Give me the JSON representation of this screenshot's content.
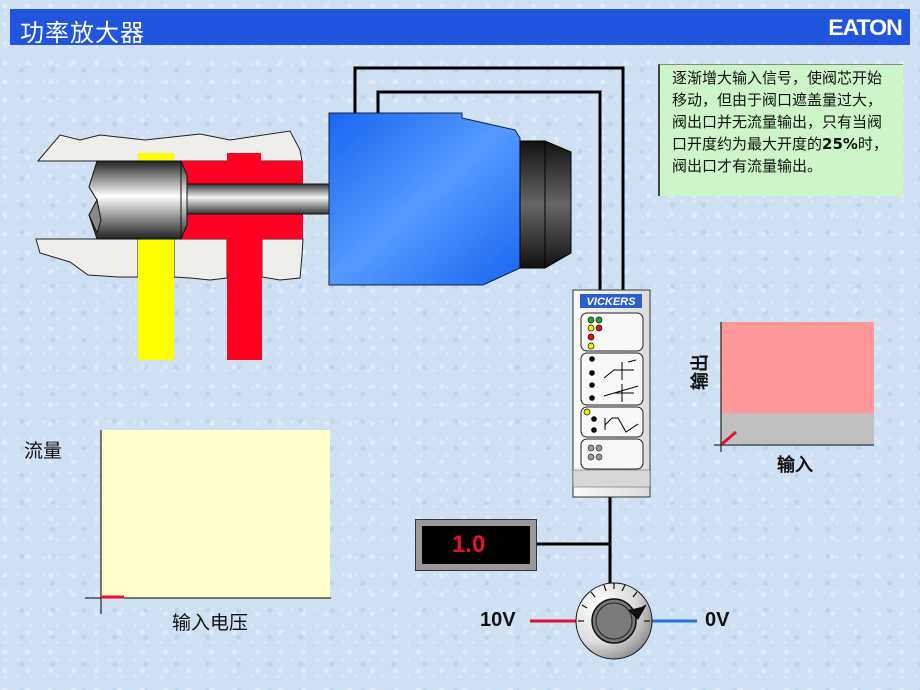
{
  "header": {
    "title": "功率放大器",
    "logo": "EATON",
    "bar_color": "#2255dd"
  },
  "note": {
    "text_parts": [
      "逐渐增大输入信号，使阀芯开始移动，但由于阀口遮盖量过大，阀出口并无流量输出，只有当阀口开度约为最大开度的",
      "25%",
      "时，阀出口才有流量输出。"
    ],
    "background": "#ccf5c8"
  },
  "amplifier": {
    "brand": "VICKERS",
    "leds_top": [
      "#22aa22",
      "#22aa22",
      "#eeee00",
      "#dd1122",
      "#dd1122",
      "#eeee00"
    ],
    "module_colors": {
      "panel": "#f0f0f0",
      "stripe": "#d8d8d8"
    }
  },
  "display": {
    "value": "1.0",
    "color": "#e8102a"
  },
  "potentiometer": {
    "left_label": "10V",
    "right_label": "0V",
    "left_wire_color": "#dd1133",
    "right_wire_color": "#2277dd"
  },
  "flow_chart": {
    "ylabel": "流量",
    "xlabel": "输入电压",
    "plot_color": "#ffffcc",
    "marker_color": "#e8102a",
    "current_input_fraction": 0.1,
    "current_flow_fraction": 0.0
  },
  "io_chart": {
    "ylabel": "输出",
    "xlabel": "输入",
    "upper_color": "#ff9999",
    "deadband_color": "#c0c0c0",
    "deadband_fraction": 0.25,
    "marker_color": "#e8102a"
  },
  "valve": {
    "tank_color": "#ffff00",
    "pressure_color": "#ff0022",
    "solenoid_color": "#3388ff"
  }
}
